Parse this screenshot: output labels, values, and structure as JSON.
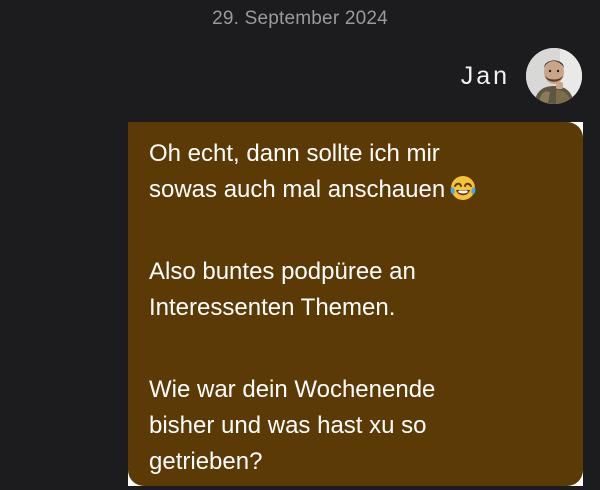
{
  "date_header": "29. September 2024",
  "sender": {
    "name": "Jan",
    "avatar_icon": "user-avatar-photo"
  },
  "message": {
    "paragraph_1": {
      "line_1": "Oh echt, dann sollte ich mir",
      "line_2": "sowas auch mal anschauen",
      "emoji": "😂"
    },
    "paragraph_2": {
      "line_1": "Also buntes podpüree an",
      "line_2": "Interessenten Themen."
    },
    "paragraph_3": {
      "line_1": "Wie war dein Wochenende",
      "line_2": "bisher und was hast xu so",
      "line_3": "getrieben?"
    }
  },
  "colors": {
    "background": "#1c1c1e",
    "bubble": "#5b3a06",
    "date_text": "#9a9a9a",
    "message_text": "#ffffff"
  }
}
